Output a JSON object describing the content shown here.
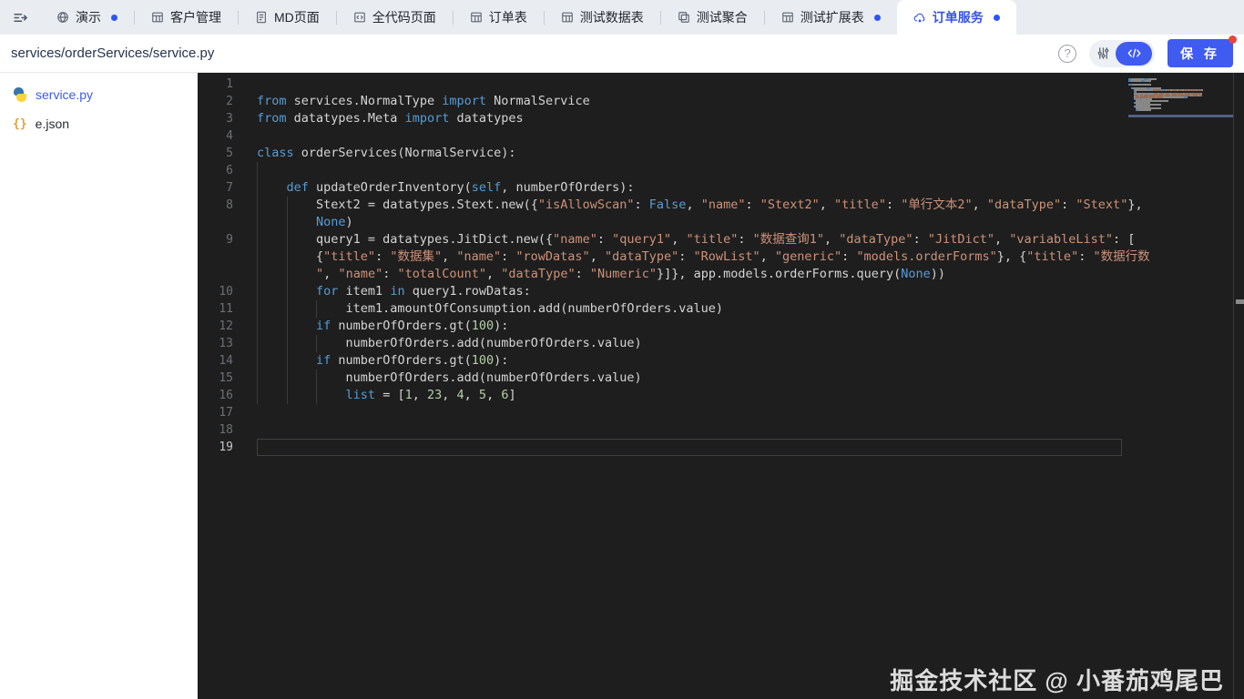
{
  "tab_bar": {
    "tabs": [
      {
        "label": "演示",
        "icon": "globe",
        "dot": true,
        "active": false
      },
      {
        "label": "客户管理",
        "icon": "table",
        "dot": false,
        "active": false
      },
      {
        "label": "MD页面",
        "icon": "document",
        "dot": false,
        "active": false
      },
      {
        "label": "全代码页面",
        "icon": "code-file",
        "dot": false,
        "active": false
      },
      {
        "label": "订单表",
        "icon": "table",
        "dot": false,
        "active": false
      },
      {
        "label": "测试数据表",
        "icon": "table",
        "dot": false,
        "active": false
      },
      {
        "label": "测试聚合",
        "icon": "merge",
        "dot": false,
        "active": false
      },
      {
        "label": "测试扩展表",
        "icon": "table",
        "dot": true,
        "active": false
      },
      {
        "label": "订单服务",
        "icon": "service",
        "dot": true,
        "active": true
      }
    ]
  },
  "toolbar": {
    "breadcrumb": "services/orderServices/service.py",
    "help_label": "?",
    "save_label": "保 存",
    "unsaved_badge": true
  },
  "sidebar": {
    "files": [
      {
        "name": "service.py",
        "icon": "python",
        "selected": true
      },
      {
        "name": "e.json",
        "icon": "json",
        "selected": false
      }
    ]
  },
  "editor": {
    "watermark": "掘金技术社区 @ 小番茄鸡尾巴",
    "current_line": 19,
    "rows": [
      {
        "n": "1",
        "g": [],
        "t": []
      },
      {
        "n": "2",
        "g": [],
        "t": [
          [
            "k",
            "from"
          ],
          [
            "p",
            " services.NormalType "
          ],
          [
            "k",
            "import"
          ],
          [
            "p",
            " NormalService"
          ]
        ]
      },
      {
        "n": "3",
        "g": [],
        "t": [
          [
            "k",
            "from"
          ],
          [
            "p",
            " datatypes.Meta "
          ],
          [
            "k",
            "import"
          ],
          [
            "p",
            " datatypes"
          ]
        ]
      },
      {
        "n": "4",
        "g": [],
        "t": []
      },
      {
        "n": "5",
        "g": [],
        "t": [
          [
            "k",
            "class"
          ],
          [
            "p",
            " orderServices(NormalService):"
          ]
        ]
      },
      {
        "n": "6",
        "g": [
          0
        ],
        "t": []
      },
      {
        "n": "7",
        "g": [
          0
        ],
        "t": [
          [
            "p",
            "    "
          ],
          [
            "k",
            "def"
          ],
          [
            "p",
            " updateOrderInventory("
          ],
          [
            "k",
            "self"
          ],
          [
            "p",
            ", numberOfOrders):"
          ]
        ]
      },
      {
        "n": "8",
        "g": [
          0,
          4
        ],
        "t": [
          [
            "p",
            "        Stext2 = datatypes.Stext.new({"
          ],
          [
            "s",
            "\"isAllowScan\""
          ],
          [
            "p",
            ": "
          ],
          [
            "k",
            "False"
          ],
          [
            "p",
            ", "
          ],
          [
            "s",
            "\"name\""
          ],
          [
            "p",
            ": "
          ],
          [
            "s",
            "\"Stext2\""
          ],
          [
            "p",
            ", "
          ],
          [
            "s",
            "\"title\""
          ],
          [
            "p",
            ": "
          ],
          [
            "s",
            "\"单行文本2\""
          ],
          [
            "p",
            ", "
          ],
          [
            "s",
            "\"dataType\""
          ],
          [
            "p",
            ": "
          ],
          [
            "s",
            "\"Stext\""
          ],
          [
            "p",
            "},"
          ]
        ]
      },
      {
        "n": "",
        "g": [
          0,
          4
        ],
        "t": [
          [
            "p",
            "        "
          ],
          [
            "k",
            "None"
          ],
          [
            "p",
            ")"
          ]
        ]
      },
      {
        "n": "9",
        "g": [
          0,
          4
        ],
        "t": [
          [
            "p",
            "        query1 = datatypes.JitDict.new({"
          ],
          [
            "s",
            "\"name\""
          ],
          [
            "p",
            ": "
          ],
          [
            "s",
            "\"query1\""
          ],
          [
            "p",
            ", "
          ],
          [
            "s",
            "\"title\""
          ],
          [
            "p",
            ": "
          ],
          [
            "s",
            "\"数据查询1\""
          ],
          [
            "p",
            ", "
          ],
          [
            "s",
            "\"dataType\""
          ],
          [
            "p",
            ": "
          ],
          [
            "s",
            "\"JitDict\""
          ],
          [
            "p",
            ", "
          ],
          [
            "s",
            "\"variableList\""
          ],
          [
            "p",
            ": ["
          ]
        ]
      },
      {
        "n": "",
        "g": [
          0,
          4
        ],
        "t": [
          [
            "p",
            "        {"
          ],
          [
            "s",
            "\"title\""
          ],
          [
            "p",
            ": "
          ],
          [
            "s",
            "\"数据集\""
          ],
          [
            "p",
            ", "
          ],
          [
            "s",
            "\"name\""
          ],
          [
            "p",
            ": "
          ],
          [
            "s",
            "\"rowDatas\""
          ],
          [
            "p",
            ", "
          ],
          [
            "s",
            "\"dataType\""
          ],
          [
            "p",
            ": "
          ],
          [
            "s",
            "\"RowList\""
          ],
          [
            "p",
            ", "
          ],
          [
            "s",
            "\"generic\""
          ],
          [
            "p",
            ": "
          ],
          [
            "s",
            "\"models.orderForms\""
          ],
          [
            "p",
            "}, {"
          ],
          [
            "s",
            "\"title\""
          ],
          [
            "p",
            ": "
          ],
          [
            "s",
            "\"数据行数"
          ]
        ]
      },
      {
        "n": "",
        "g": [
          0,
          4
        ],
        "t": [
          [
            "p",
            "        "
          ],
          [
            "s",
            "\""
          ],
          [
            "p",
            ", "
          ],
          [
            "s",
            "\"name\""
          ],
          [
            "p",
            ": "
          ],
          [
            "s",
            "\"totalCount\""
          ],
          [
            "p",
            ", "
          ],
          [
            "s",
            "\"dataType\""
          ],
          [
            "p",
            ": "
          ],
          [
            "s",
            "\"Numeric\""
          ],
          [
            "p",
            "}]}, app.models.orderForms.query("
          ],
          [
            "k",
            "None"
          ],
          [
            "p",
            "))"
          ]
        ]
      },
      {
        "n": "10",
        "g": [
          0,
          4
        ],
        "t": [
          [
            "p",
            "        "
          ],
          [
            "k",
            "for"
          ],
          [
            "p",
            " item1 "
          ],
          [
            "k",
            "in"
          ],
          [
            "p",
            " query1.rowDatas:"
          ]
        ]
      },
      {
        "n": "11",
        "g": [
          0,
          4,
          8
        ],
        "t": [
          [
            "p",
            "            item1.amountOfConsumption.add(numberOfOrders.value)"
          ]
        ]
      },
      {
        "n": "12",
        "g": [
          0,
          4
        ],
        "t": [
          [
            "p",
            "        "
          ],
          [
            "k",
            "if"
          ],
          [
            "p",
            " numberOfOrders.gt("
          ],
          [
            "n",
            "100"
          ],
          [
            "p",
            "):"
          ]
        ]
      },
      {
        "n": "13",
        "g": [
          0,
          4,
          8
        ],
        "t": [
          [
            "p",
            "            numberOfOrders.add(numberOfOrders.value)"
          ]
        ]
      },
      {
        "n": "14",
        "g": [
          0,
          4
        ],
        "t": [
          [
            "p",
            "        "
          ],
          [
            "k",
            "if"
          ],
          [
            "p",
            " numberOfOrders.gt("
          ],
          [
            "n",
            "100"
          ],
          [
            "p",
            "):"
          ]
        ]
      },
      {
        "n": "15",
        "g": [
          0,
          4,
          8
        ],
        "t": [
          [
            "p",
            "            numberOfOrders.add(numberOfOrders.value)"
          ]
        ]
      },
      {
        "n": "16",
        "g": [
          0,
          4,
          8
        ],
        "t": [
          [
            "p",
            "            "
          ],
          [
            "k",
            "list"
          ],
          [
            "p",
            " = ["
          ],
          [
            "n",
            "1"
          ],
          [
            "p",
            ", "
          ],
          [
            "n",
            "23"
          ],
          [
            "p",
            ", "
          ],
          [
            "n",
            "4"
          ],
          [
            "p",
            ", "
          ],
          [
            "n",
            "5"
          ],
          [
            "p",
            ", "
          ],
          [
            "n",
            "6"
          ],
          [
            "p",
            "]"
          ]
        ]
      },
      {
        "n": "17",
        "g": [],
        "t": []
      },
      {
        "n": "18",
        "g": [],
        "t": []
      },
      {
        "n": "19",
        "g": [],
        "t": [],
        "cur": true
      }
    ]
  },
  "colors": {
    "accent": "#3f5bf0",
    "tabbar_bg": "#e9ecf1",
    "editor_bg": "#1e1e1e",
    "keyword": "#569cd6",
    "string": "#ce9178",
    "number": "#b5cea8",
    "plain_code": "#d4d4d4",
    "unsaved_dot": "#2e55f2",
    "badge_red": "#e54545"
  }
}
